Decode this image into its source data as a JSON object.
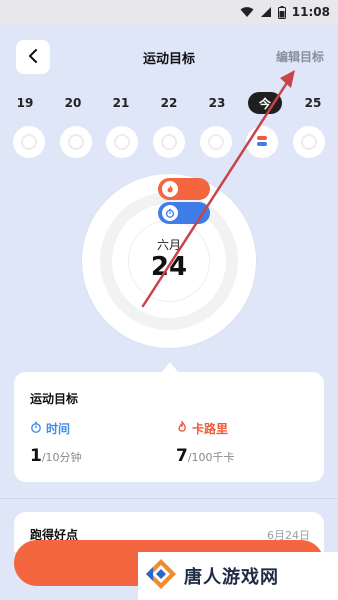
{
  "status_bar": {
    "time": "11:08"
  },
  "header": {
    "title": "运动目标",
    "edit_label": "编辑目标"
  },
  "dates": [
    {
      "label": "19",
      "active": false
    },
    {
      "label": "20",
      "active": false
    },
    {
      "label": "21",
      "active": false
    },
    {
      "label": "22",
      "active": false
    },
    {
      "label": "23",
      "active": false
    },
    {
      "label": "今",
      "active": true
    },
    {
      "label": "25",
      "active": false
    }
  ],
  "ring": {
    "month": "六月",
    "day": "24"
  },
  "goal_card": {
    "title": "运动目标",
    "time_label": "时间",
    "time_value": "1",
    "time_target": "/10分钟",
    "cal_label": "卡路里",
    "cal_value": "7",
    "cal_target": "/100千卡"
  },
  "next_card": {
    "title": "跑得好点",
    "date": "6月24日"
  },
  "watermark": {
    "text": "唐人游戏网"
  },
  "colors": {
    "accent_orange": "#f4663f",
    "accent_blue": "#3f7de8",
    "annotation_arrow": "#c9434a"
  }
}
